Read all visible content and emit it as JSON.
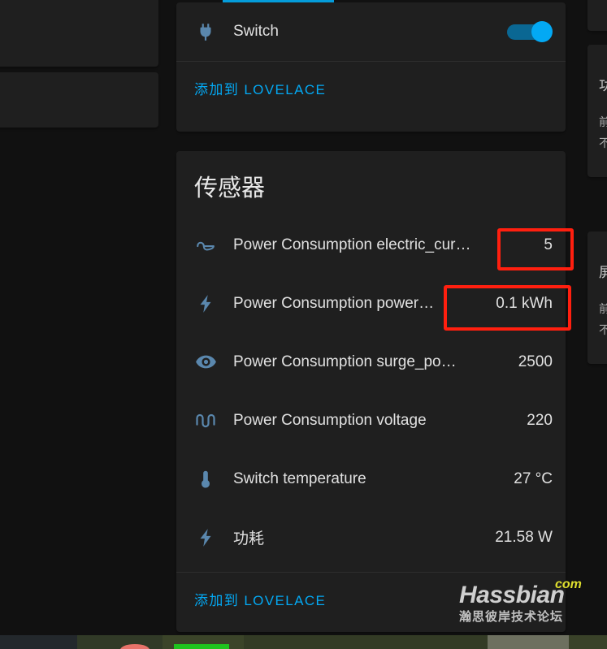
{
  "theme": {
    "page_bg": "#111111",
    "card_bg": "#1f1f1f",
    "accent": "#03a9f4",
    "icon_color": "#5a87ad",
    "text_primary": "#e1e1e1",
    "annotation": "#ff1f0f"
  },
  "switch_card": {
    "row": {
      "icon": "power-plug-icon",
      "label": "Switch",
      "toggle_state": "on"
    },
    "action_label": "添加到 LOVELACE"
  },
  "sensors_card": {
    "title": "传感器",
    "action_label": "添加到 LOVELACE",
    "rows": [
      {
        "icon": "current-ac-icon",
        "label": "Power Consumption electric_cur…",
        "value": "5"
      },
      {
        "icon": "lightning-bolt-icon",
        "label": "Power Consumption power…",
        "value": "0.1 kWh"
      },
      {
        "icon": "eye-icon",
        "label": "Power Consumption surge_po…",
        "value": "2500"
      },
      {
        "icon": "sine-wave-icon",
        "label": "Power Consumption voltage",
        "value": "220"
      },
      {
        "icon": "thermometer-icon",
        "label": "Switch temperature",
        "value": "27 °C"
      },
      {
        "icon": "lightning-bolt-icon",
        "label": "功耗",
        "value": "21.58 W"
      }
    ]
  },
  "annotations": [
    {
      "name": "highlight-electric-current-value",
      "target": "5"
    },
    {
      "name": "highlight-power-kwh-value",
      "target": "0.1 kWh"
    }
  ],
  "right_panel_clipped": {
    "card_b_lines": [
      "功",
      "前",
      "不"
    ],
    "card_c_lines": [
      "屏",
      "前",
      "不"
    ]
  },
  "watermark": {
    "name": "Hassbian",
    "tld": "com",
    "subtitle": "瀚思彼岸技术论坛"
  }
}
